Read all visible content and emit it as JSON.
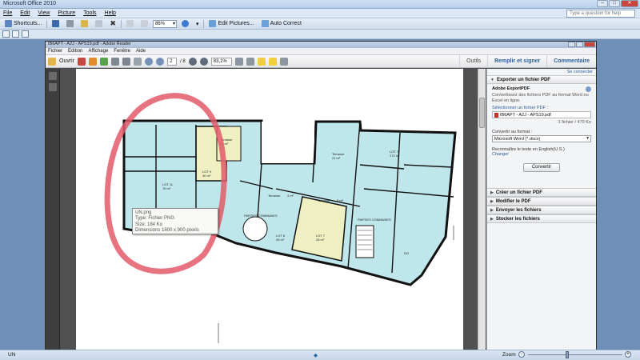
{
  "office": {
    "title": "Microsoft Office 2010",
    "menu": [
      "File",
      "Edit",
      "View",
      "Picture",
      "Tools",
      "Help"
    ],
    "help_placeholder": "Type a question for help",
    "toolbar": {
      "shortcuts": "Shortcuts...",
      "zoom": "86%",
      "edit_pictures": "Edit Pictures...",
      "auto_correct": "Auto Correct"
    }
  },
  "reader": {
    "title": "IB6APT - A2J - APS19.pdf - Adobe Reader",
    "menu": [
      "Fichier",
      "Edition",
      "Affichage",
      "Fenêtre",
      "Aide"
    ],
    "toolbar": {
      "open": "Ouvrir",
      "page_current": "2",
      "page_total": "/ 8",
      "zoom": "83,1%",
      "tools": "Outils",
      "fill_sign": "Remplir et signer",
      "comment": "Commentaire"
    },
    "panel": {
      "sign_in": "Se connecter",
      "export_header": "Exporter un fichier PDF",
      "service_name": "Adobe ExportPDF",
      "service_desc": "Convertissez des fichiers PDF au format Word ou Excel en ligne.",
      "select_label": "Sélectionner un fichier PDF :",
      "file_name": "IB6APT - A2J - APS19.pdf",
      "file_count": "1 fichier / 470 Ko",
      "convert_label": "Convertir au format :",
      "format": "Microsoft Word (*.docx)",
      "recognize": "Reconnaître le texte en English(U.S.)",
      "change": "Changer",
      "convert_button": "Convertir",
      "sections": [
        "Créer un fichier PDF",
        "Modifier le PDF",
        "Envoyer les fichiers",
        "Stocker les fichiers"
      ]
    }
  },
  "tooltip": {
    "line1": "UN.png",
    "line2": "Type: Fichier PNG",
    "line3": "Size: 184 Ko",
    "line4": "Dimensions 1800 x 900 pixels"
  },
  "floorplan": {
    "rooms": [
      {
        "label": "LOT 11",
        "area": "76 m²"
      },
      {
        "label": "LOT 9",
        "area": "40 m²"
      },
      {
        "label": "Terrasse",
        "area": "72 m²"
      },
      {
        "label": "Terrasse",
        "area": "4 m²"
      },
      {
        "label": "Terrasse",
        "area": "5 m²"
      },
      {
        "label": "Terrasse",
        "area": "21 m²"
      },
      {
        "label": "LOT 7",
        "area": "172 m²"
      },
      {
        "label": "LOT 6",
        "area": "26 m²"
      },
      {
        "label": "LOT 7",
        "area": "28 m²"
      },
      {
        "label": "PARTIES COMMUNES",
        "area": ""
      },
      {
        "label": "PARTIES COMMUNES",
        "area": ""
      },
      {
        "label": "DG",
        "area": ""
      }
    ]
  },
  "status": {
    "language": "UN",
    "zoom_label": "Zoom"
  },
  "colors": {
    "room_blue": "#bfe6ea",
    "room_yellow": "#eef0c2",
    "wall": "#111111",
    "annotation_red": "#e35a6b",
    "accent": "#2a5f9e"
  }
}
